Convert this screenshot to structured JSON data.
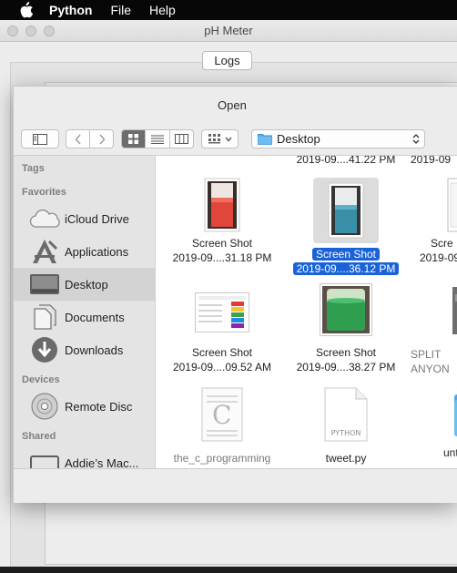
{
  "menubar": {
    "app_name": "Python",
    "items": [
      "File",
      "Help"
    ]
  },
  "window": {
    "title": "pH Meter",
    "logs_button": "Logs"
  },
  "open_dialog": {
    "title": "Open",
    "location": "Desktop",
    "sidebar": {
      "sections": [
        {
          "header": "Tags",
          "items": []
        },
        {
          "header": "Favorites",
          "items": [
            {
              "label": "iCloud Drive",
              "icon": "cloud-icon"
            },
            {
              "label": "Applications",
              "icon": "applications-icon"
            },
            {
              "label": "Desktop",
              "icon": "desktop-icon",
              "selected": true
            },
            {
              "label": "Documents",
              "icon": "documents-icon"
            },
            {
              "label": "Downloads",
              "icon": "downloads-icon"
            }
          ]
        },
        {
          "header": "Devices",
          "items": [
            {
              "label": "Remote Disc",
              "icon": "disc-icon"
            }
          ]
        },
        {
          "header": "Shared",
          "items": [
            {
              "label": "Addie’s Mac...",
              "icon": "computer-icon"
            }
          ]
        }
      ]
    },
    "files": {
      "top_partial": [
        {
          "date": "2019-09....41.22 PM"
        },
        {
          "date": "2019-09"
        }
      ],
      "row1": [
        {
          "name": "Screen Shot",
          "date": "2019-09....31.18 PM",
          "thumb": "red-liquid"
        },
        {
          "name": "Screen Shot",
          "date": "2019-09....36.12 PM",
          "thumb": "blue-liquid",
          "selected": true
        },
        {
          "name": "Scre",
          "date": "2019-09",
          "thumb": "document"
        }
      ],
      "row2": [
        {
          "name": "Screen Shot",
          "date": "2019-09....09.52 AM",
          "thumb": "table"
        },
        {
          "name": "Screen Shot",
          "date": "2019-09....38.27 PM",
          "thumb": "green-liquid"
        },
        {
          "name": "SPLIT",
          "date": "ANYON",
          "thumb": "book"
        }
      ],
      "row3": [
        {
          "name": "the_c_programming",
          "thumb": "c-book"
        },
        {
          "name": "tweet.py",
          "thumb": "python-file",
          "badge": "PYTHON"
        },
        {
          "name": "unti",
          "thumb": "folder"
        }
      ]
    },
    "colors": {
      "selection": "#1a62d6",
      "folder_blue": "#4fa6e8"
    }
  }
}
